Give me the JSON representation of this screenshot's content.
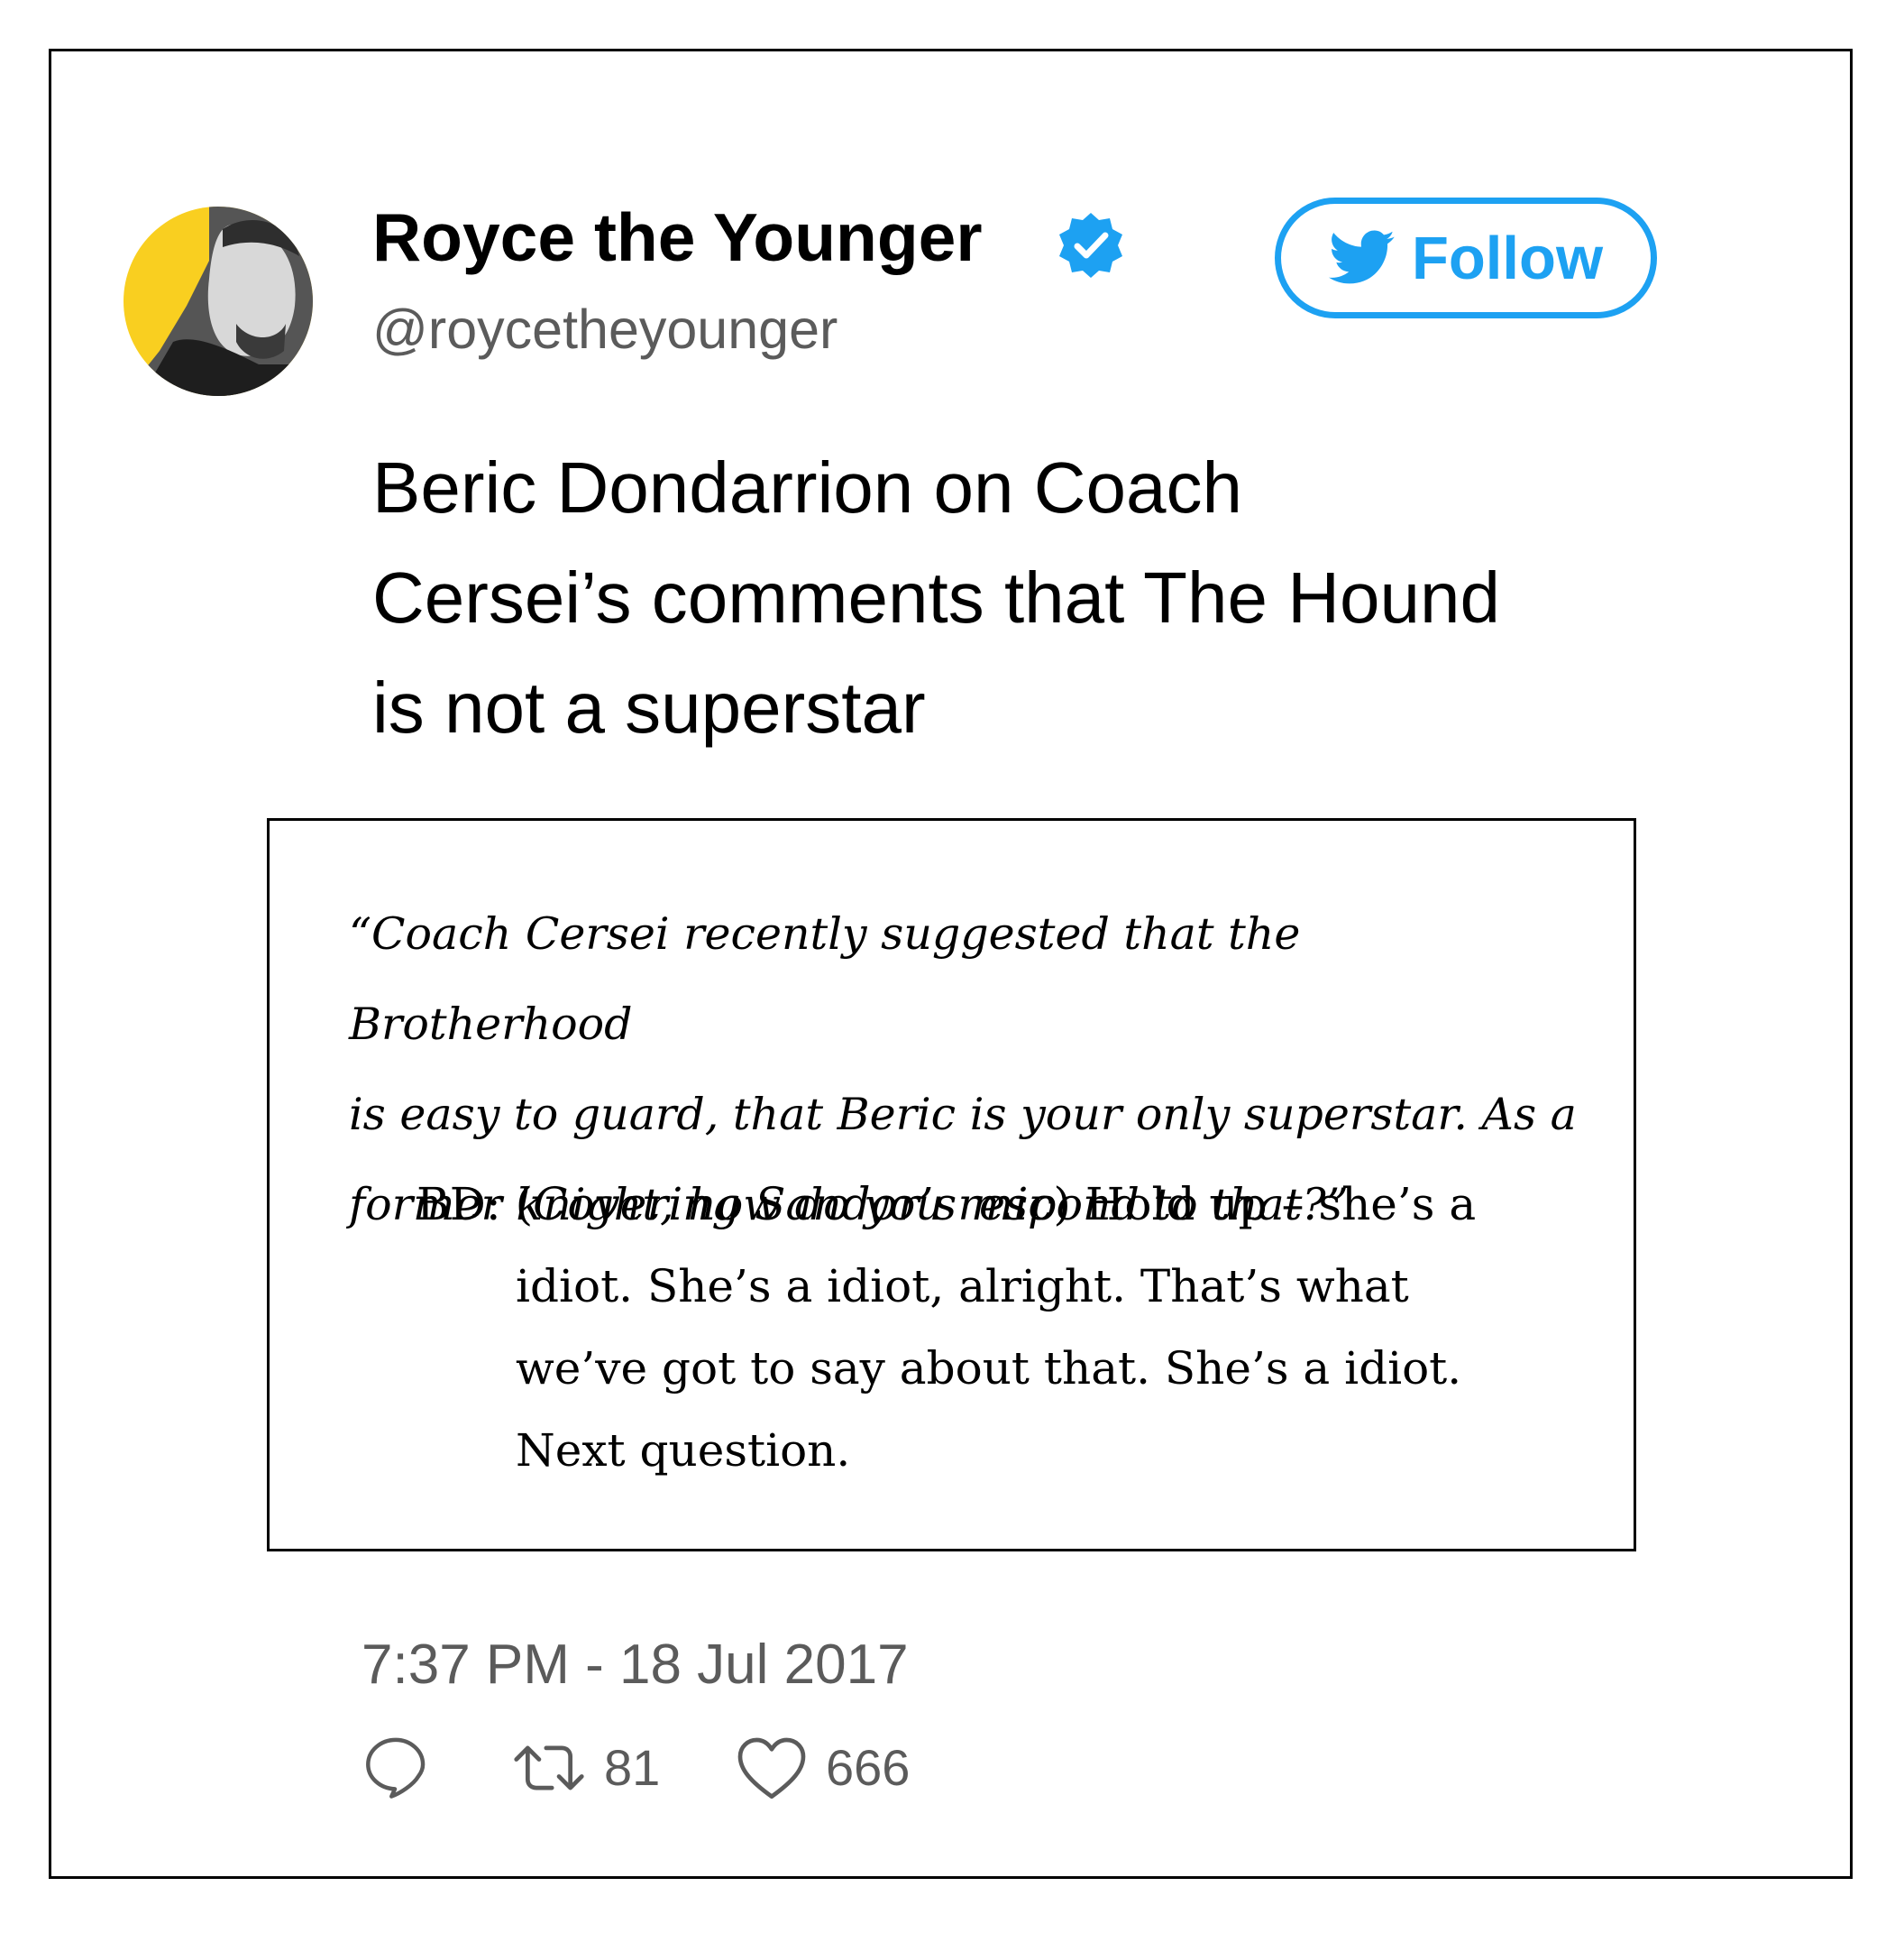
{
  "user": {
    "display_name": "Royce the Younger",
    "handle": "@roycetheyounger",
    "verified": true,
    "avatar_icon": "avatar-photo"
  },
  "follow_button": {
    "label": "Follow",
    "icon": "twitter-bird-icon"
  },
  "tweet": {
    "text_lines": [
      "Beric Dondarrion on Coach",
      "Cersei’s comments that The Hound",
      "is not a superstar"
    ]
  },
  "quote": {
    "question_lines": [
      "“Coach Cersei recently suggested that the Brotherhood",
      "is easy to guard, that Beric is your only superstar. As a",
      "former knight, how do you respond to that?”"
    ],
    "answer": {
      "speaker": "BD: ",
      "paren_open": "(",
      "stage_direction": "Covering Sandor’s mic",
      "paren_close": ")",
      "text_first": " Hold up – she’s a",
      "lines": [
        "idiot. She’s a idiot, alright. That’s what",
        "we’ve got to say about that. She’s a idiot.",
        "Next question."
      ]
    }
  },
  "timestamp": "7:37 PM - 18 Jul 2017",
  "actions": {
    "reply": {
      "icon": "reply-icon"
    },
    "retweet": {
      "icon": "retweet-icon",
      "count": "81"
    },
    "like": {
      "icon": "heart-icon",
      "count": "666"
    }
  },
  "colors": {
    "accent": "#1da1f2",
    "muted_text": "#5b5b5b",
    "avatar_bg": "#f9cf20"
  }
}
